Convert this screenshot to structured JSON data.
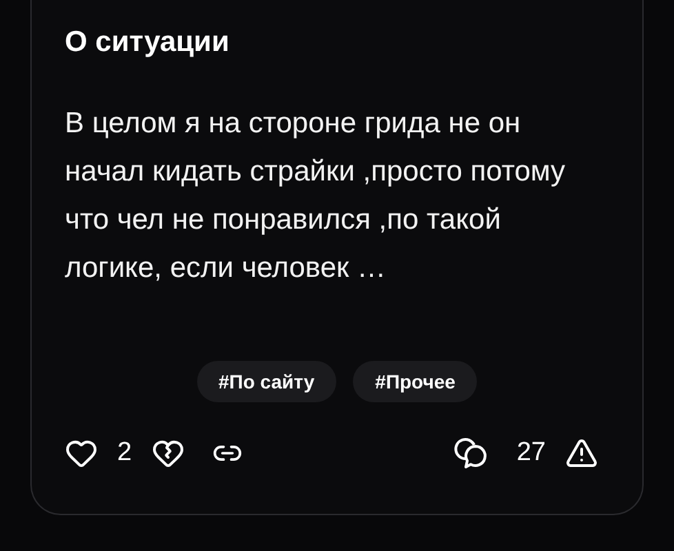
{
  "post": {
    "title": "О ситуации",
    "body": "В целом я на стороне грида не он начал кидать страйки ,просто потому что чел не понравился ,по такой логике, если человек …",
    "tags": [
      "#По сайту",
      "#Прочее"
    ],
    "likes": "2",
    "comments": "27"
  }
}
